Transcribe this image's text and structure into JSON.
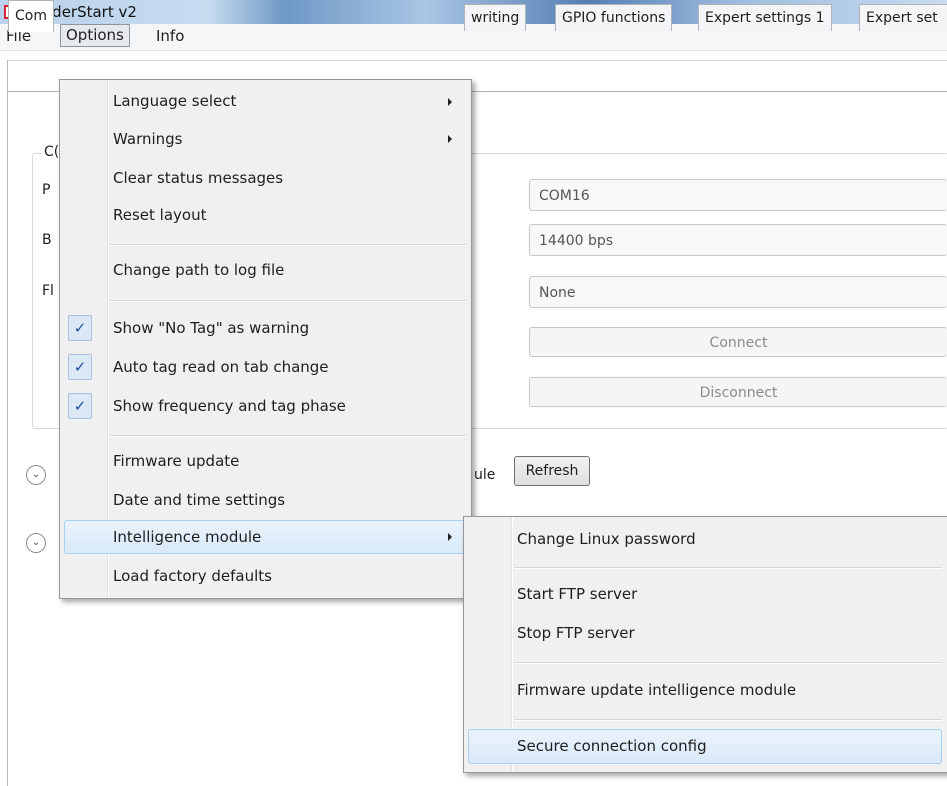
{
  "window": {
    "title": "ReaderStart v2"
  },
  "menubar": {
    "file": "File",
    "options": "Options",
    "info": "Info"
  },
  "tabs": [
    "Com",
    "writing",
    "GPIO functions",
    "Expert settings 1",
    "Expert set"
  ],
  "group": {
    "title": "C(",
    "labels": [
      "P",
      "B",
      "Fl"
    ],
    "port_value": "COM16",
    "baud_value": "14400 bps",
    "flow_value": "None",
    "connect_label": "Connect",
    "disconnect_label": "Disconnect"
  },
  "module_row": {
    "partial_label": "ule",
    "refresh_label": "Refresh"
  },
  "options_menu": {
    "language": "Language select",
    "warnings": "Warnings",
    "clear_status": "Clear status messages",
    "reset_layout": "Reset layout",
    "change_log_path": "Change path to log file",
    "show_no_tag": "Show \"No Tag\" as warning",
    "auto_tag_read": "Auto tag read on tab change",
    "show_frequency": "Show frequency and tag phase",
    "firmware_update": "Firmware update",
    "date_time": "Date and time settings",
    "intelligence_module": "Intelligence module",
    "load_defaults": "Load factory defaults",
    "check_mark": "✓"
  },
  "submenu": {
    "change_linux_password": "Change Linux password",
    "start_ftp": "Start FTP server",
    "stop_ftp": "Stop FTP server",
    "firmware_update_module": "Firmware update intelligence module",
    "secure_connection": "Secure connection config"
  },
  "icons": {
    "app": "reader-logo-icon",
    "expander": "chevron-down-icon",
    "submenu_arrow": "triangle-right-icon"
  },
  "colors": {
    "highlight": "#d9e9f8",
    "check": "#1f4f9a",
    "logo": "#d4232a"
  }
}
